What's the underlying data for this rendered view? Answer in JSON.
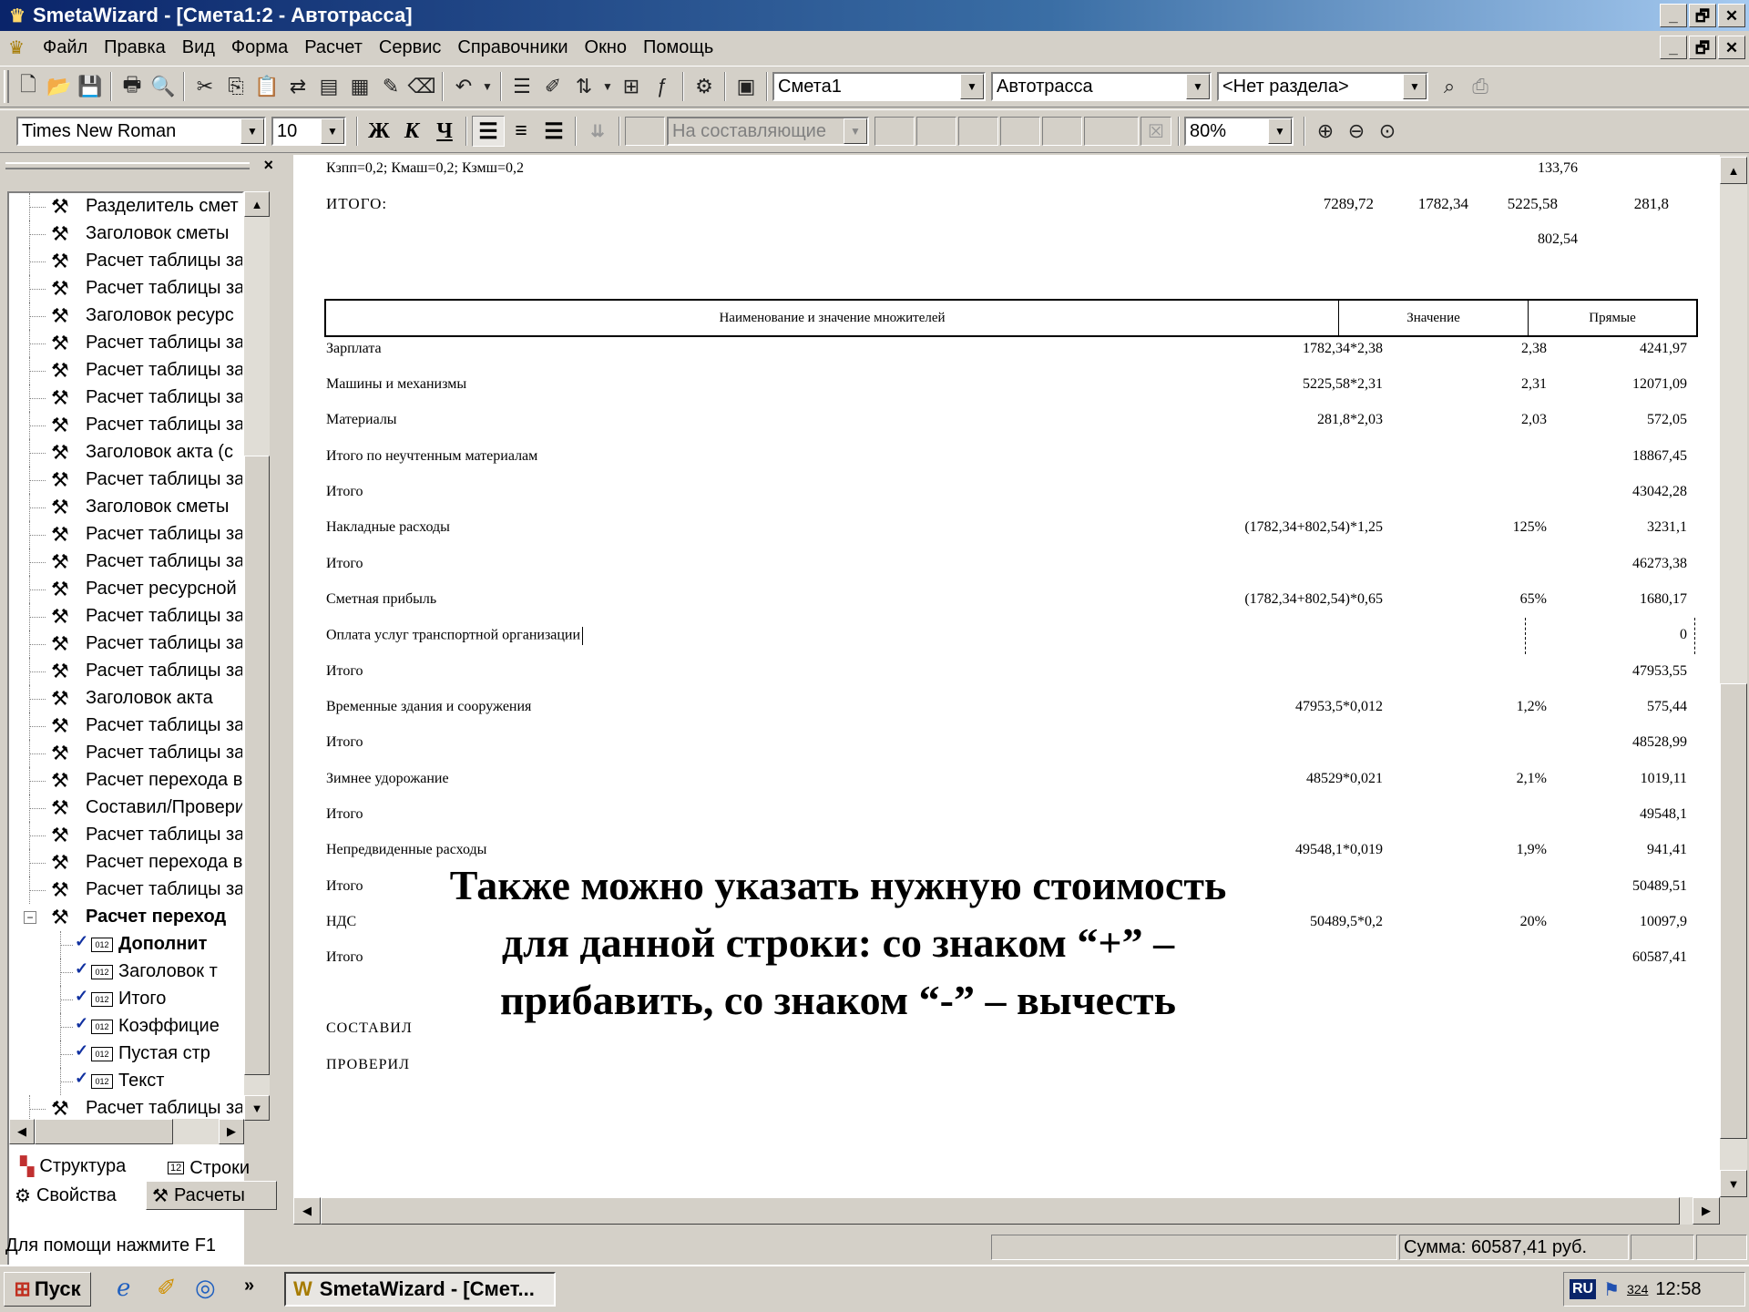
{
  "window": {
    "title": "SmetaWizard - [Смета1:2 - Автотрасса]",
    "minimize": "_",
    "maximize": "🗗",
    "close": "✕"
  },
  "menu": [
    "Файл",
    "Правка",
    "Вид",
    "Форма",
    "Расчет",
    "Сервис",
    "Справочники",
    "Окно",
    "Помощь"
  ],
  "toolbar": {
    "estimate_combo": "Смета1",
    "object_combo": "Автотрасса",
    "section_combo": "<Нет раздела>"
  },
  "format_toolbar": {
    "font": "Times New Roman",
    "size": "10",
    "bold": "Ж",
    "italic": "К",
    "underline": "Ч",
    "components_combo": "На составляющие",
    "zoom": "80%"
  },
  "tree": {
    "items": [
      "Разделитель смет",
      "Заголовок сметы",
      "Расчет таблицы за",
      "Расчет таблицы за",
      "Заголовок ресурс",
      "Расчет таблицы за",
      "Расчет таблицы за",
      "Расчет таблицы за",
      "Расчет таблицы за",
      "Заголовок акта (с",
      "Расчет таблицы за",
      "Заголовок сметы",
      "Расчет таблицы за",
      "Расчет таблицы за",
      "Расчет ресурсной",
      "Расчет таблицы за",
      "Расчет таблицы за",
      "Расчет таблицы за",
      "Заголовок акта",
      "Расчет таблицы за",
      "Расчет таблицы за",
      "Расчет перехода в",
      "Составил/Провери",
      "Расчет таблицы за",
      "Расчет перехода в",
      "Расчет таблицы за"
    ],
    "expanded": "Расчет переход",
    "children": [
      "Дополнит",
      "Заголовок т",
      "Итого",
      "Коэффицие",
      "Пустая стр",
      "Текст"
    ],
    "last": "Расчет таблицы за"
  },
  "tabs": {
    "structure": "Структура",
    "rows": "Строки",
    "properties": "Свойства",
    "calculations": "Расчеты"
  },
  "document": {
    "coef_line": "Кзпп=0,2; Кмаш=0,2; Кзмш=0,2",
    "coef_value": "133,76",
    "total_label": "ИТОГО:",
    "totals": [
      "7289,72",
      "1782,34",
      "5225,58",
      "281,8"
    ],
    "extra_total": "802,54",
    "headers": [
      "Наименование и значение множителей",
      "Значение",
      "Прямые"
    ],
    "rows": [
      {
        "name": "Зарплата",
        "formula": "1782,34*2,38",
        "value": "2,38",
        "direct": "4241,97"
      },
      {
        "name": "Машины и механизмы",
        "formula": "5225,58*2,31",
        "value": "2,31",
        "direct": "12071,09"
      },
      {
        "name": "Материалы",
        "formula": "281,8*2,03",
        "value": "2,03",
        "direct": "572,05"
      },
      {
        "name": "Итого по неучтенным материалам",
        "formula": "",
        "value": "",
        "direct": "18867,45"
      },
      {
        "name": "Итого",
        "formula": "",
        "value": "",
        "direct": "43042,28"
      },
      {
        "name": "Накладные расходы",
        "formula": "(1782,34+802,54)*1,25",
        "value": "125%",
        "direct": "3231,1"
      },
      {
        "name": "Итого",
        "formula": "",
        "value": "",
        "direct": "46273,38"
      },
      {
        "name": "Сметная прибыль",
        "formula": "(1782,34+802,54)*0,65",
        "value": "65%",
        "direct": "1680,17"
      },
      {
        "name": "Оплата услуг транспортной организации",
        "formula": "",
        "value": "",
        "direct": "0"
      },
      {
        "name": "Итого",
        "formula": "",
        "value": "",
        "direct": "47953,55"
      },
      {
        "name": "Временные здания и сооружения",
        "formula": "47953,5*0,012",
        "value": "1,2%",
        "direct": "575,44"
      },
      {
        "name": "Итого",
        "formula": "",
        "value": "",
        "direct": "48528,99"
      },
      {
        "name": "Зимнее удорожание",
        "formula": "48529*0,021",
        "value": "2,1%",
        "direct": "1019,11"
      },
      {
        "name": "Итого",
        "formula": "",
        "value": "",
        "direct": "49548,1"
      },
      {
        "name": "Непредвиденные расходы",
        "formula": "49548,1*0,019",
        "value": "1,9%",
        "direct": "941,41"
      },
      {
        "name": "Итого",
        "formula": "",
        "value": "",
        "direct": "50489,51"
      },
      {
        "name": "НДС",
        "formula": "50489,5*0,2",
        "value": "20%",
        "direct": "10097,9"
      },
      {
        "name": "Итого",
        "formula": "",
        "value": "",
        "direct": "60587,41"
      }
    ],
    "composed": "СОСТАВИЛ",
    "checked": "ПРОВЕРИЛ"
  },
  "overlay_text": [
    "Также можно указать нужную стоимость",
    "для данной строки: со знаком “+” –",
    "прибавить, со знаком “-” – вычесть"
  ],
  "status": {
    "help": "Для помощи нажмите F1",
    "sum": "Сумма: 60587,41 руб."
  },
  "taskbar": {
    "start": "Пуск",
    "chevron": "»",
    "task": "SmetaWizard - [Смет...",
    "lang": "RU",
    "tray_num": "324",
    "time": "12:58"
  }
}
